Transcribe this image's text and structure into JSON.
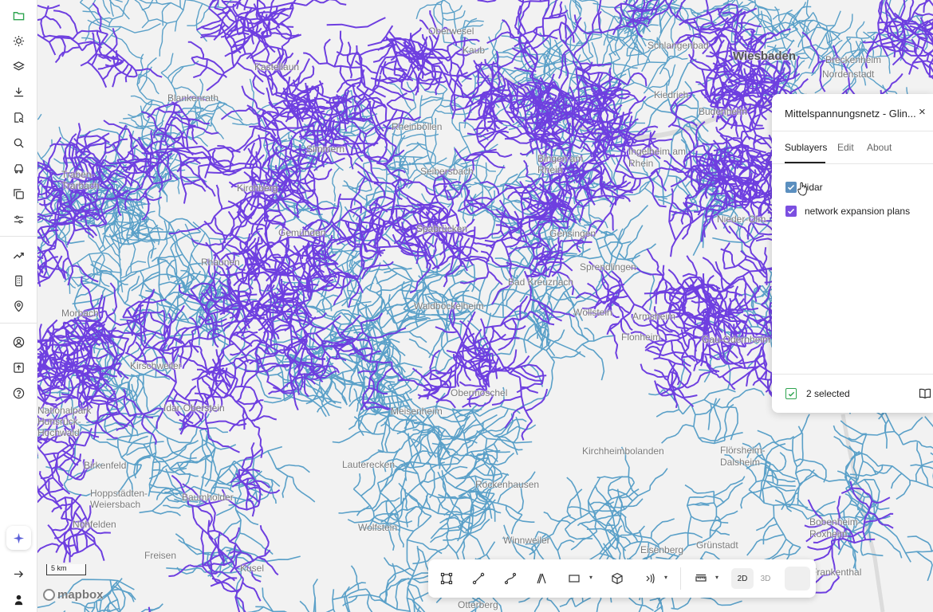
{
  "sidebar": {
    "items": [
      {
        "icon": "folder-icon"
      },
      {
        "icon": "sun-icon"
      },
      {
        "icon": "layers-icon"
      },
      {
        "icon": "download-icon"
      },
      {
        "icon": "search-file-icon"
      },
      {
        "icon": "search-icon"
      },
      {
        "icon": "car-icon"
      },
      {
        "icon": "copy-icon"
      },
      {
        "icon": "sliders-icon"
      },
      {
        "icon": "trend-icon"
      },
      {
        "icon": "building-icon"
      },
      {
        "icon": "location-pin-icon"
      },
      {
        "icon": "user-icon"
      },
      {
        "icon": "upload-icon"
      },
      {
        "icon": "help-icon"
      },
      {
        "icon": "sparkle-icon"
      },
      {
        "icon": "arrow-right-icon"
      },
      {
        "icon": "person-icon"
      }
    ],
    "accent": "#2ea44f"
  },
  "map": {
    "attribution_logo": "mapbox",
    "scale_label": "5 km",
    "colors": {
      "network_primary": "#6e3fe0",
      "network_secondary": "#5aa0c8",
      "background": "#f2f2f2"
    },
    "places": [
      {
        "name": "Wiesbaden",
        "major": true
      },
      {
        "name": "Oberwesel"
      },
      {
        "name": "Kaub"
      },
      {
        "name": "Schlangenbad"
      },
      {
        "name": "Breckenheim"
      },
      {
        "name": "Nordenstadt"
      },
      {
        "name": "Kastellaun"
      },
      {
        "name": "Blankenrath"
      },
      {
        "name": "Kiedrich"
      },
      {
        "name": "Budenheim"
      },
      {
        "name": "Rheinböllen"
      },
      {
        "name": "Simmern"
      },
      {
        "name": "Ingelheim am Rhein"
      },
      {
        "name": "Bingen am Rhein"
      },
      {
        "name": "Seibersbach"
      },
      {
        "name": "Kirchberg"
      },
      {
        "name": "Traben-Trarbach"
      },
      {
        "name": "Gemünden"
      },
      {
        "name": "Spabrücken"
      },
      {
        "name": "Gensingen"
      },
      {
        "name": "Nieder-Olm"
      },
      {
        "name": "Sprendlingen"
      },
      {
        "name": "Bad Kreuznach"
      },
      {
        "name": "Rhaunen"
      },
      {
        "name": "Waldböckelheim"
      },
      {
        "name": "Wöllstein"
      },
      {
        "name": "Armsheim"
      },
      {
        "name": "Morbach"
      },
      {
        "name": "Flonheim"
      },
      {
        "name": "Gau-Odernheim"
      },
      {
        "name": "Kirschweiler"
      },
      {
        "name": "Meisenheim"
      },
      {
        "name": "Obermoschel"
      },
      {
        "name": "Idar-Oberstein"
      },
      {
        "name": "Kirchheimbolanden"
      },
      {
        "name": "Birkenfeld"
      },
      {
        "name": "Lauterecken"
      },
      {
        "name": "Flörsheim-Dalsheim"
      },
      {
        "name": "Rockenhausen"
      },
      {
        "name": "Baumholder"
      },
      {
        "name": "Wolfstein"
      },
      {
        "name": "Bobenheim-Roxheim"
      },
      {
        "name": "Winnweiler"
      },
      {
        "name": "Eisenberg"
      },
      {
        "name": "Grünstadt"
      },
      {
        "name": "Frankenthal"
      },
      {
        "name": "Kusel"
      },
      {
        "name": "Otterberg"
      },
      {
        "name": "Nohfelden"
      },
      {
        "name": "Freisen"
      },
      {
        "name": "Hoppstädten-Weiersbach"
      },
      {
        "name": "Nationalpark Hunsrück-Hochwald"
      }
    ]
  },
  "panel": {
    "title": "Mittelspannungsnetz - Glin...",
    "close_label": "×",
    "tabs": [
      "Sublayers",
      "Edit",
      "About"
    ],
    "sublayers": [
      {
        "label": "lidar",
        "color": "#5b8fbf",
        "checked": true
      },
      {
        "label": "network expansion plans",
        "color": "#7b4fe0",
        "checked": true
      }
    ],
    "selected_label": "2 selected"
  },
  "toolbar": {
    "tools": [
      "select-area-icon",
      "line-tool-icon",
      "curve-tool-icon",
      "measure-icon",
      "rectangle-icon",
      "cube-icon",
      "signal-icon",
      "ruler-icon"
    ],
    "mode_2d": "2D",
    "mode_3d": "3D",
    "active_mode": "2D"
  }
}
